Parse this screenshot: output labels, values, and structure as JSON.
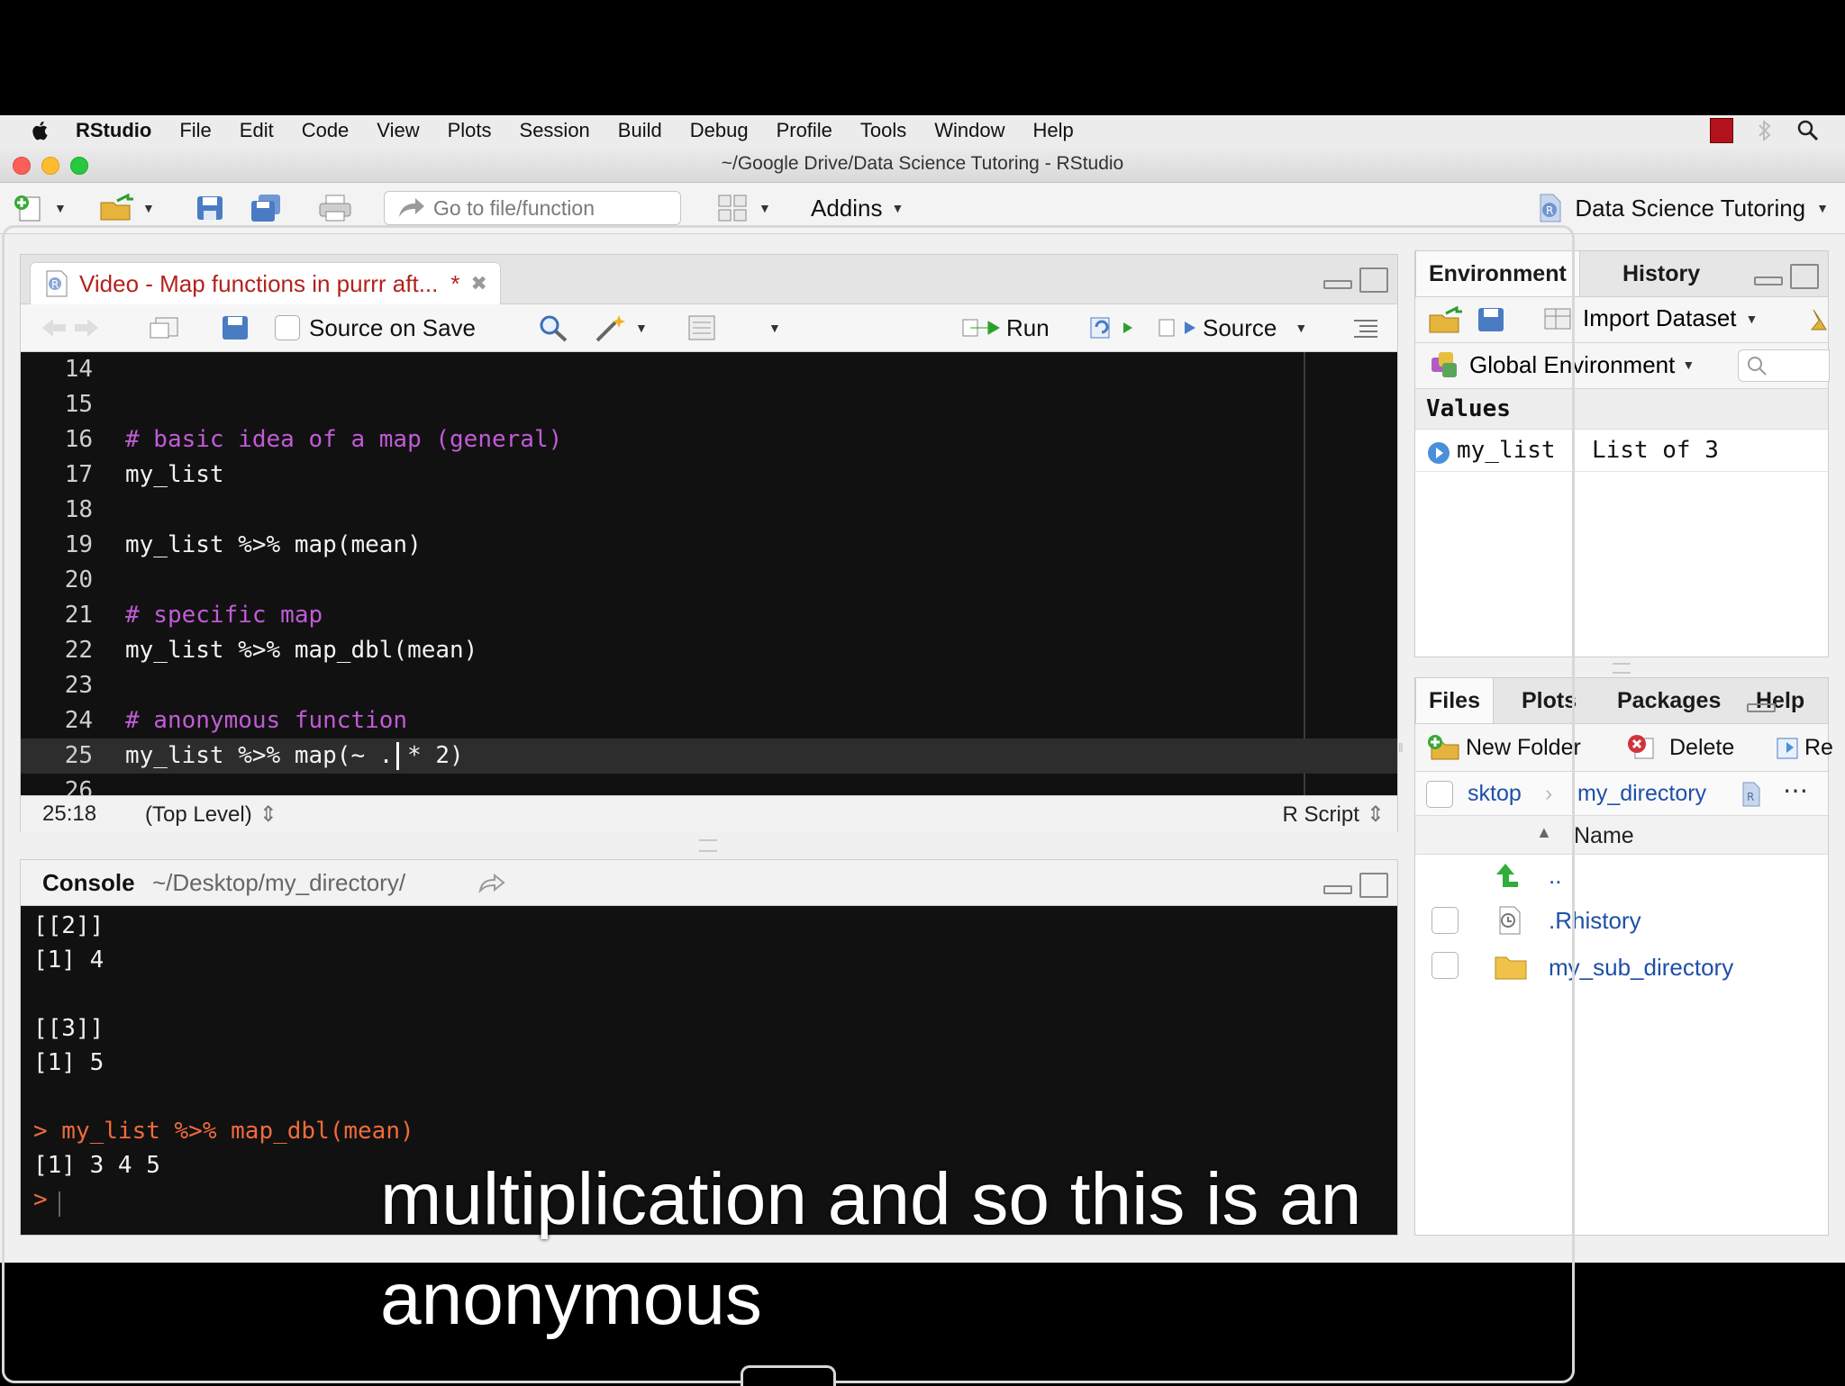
{
  "menubar": {
    "app_name": "RStudio",
    "items": [
      "File",
      "Edit",
      "Code",
      "View",
      "Plots",
      "Session",
      "Build",
      "Debug",
      "Profile",
      "Tools",
      "Window",
      "Help"
    ]
  },
  "window": {
    "title": "~/Google Drive/Data Science Tutoring - RStudio"
  },
  "toolbar": {
    "goto_placeholder": "Go to file/function",
    "addins_label": "Addins",
    "project_label": "Data Science Tutoring"
  },
  "editor": {
    "tab_title": "Video - Map functions in purrr aft...",
    "tab_modified": "*",
    "source_on_save_label": "Source on Save",
    "run_label": "Run",
    "source_label": "Source",
    "lines": [
      {
        "num": "14",
        "text": "",
        "type": "code"
      },
      {
        "num": "15",
        "text": "",
        "type": "code"
      },
      {
        "num": "16",
        "text": "# basic idea of a map (general)",
        "type": "comment"
      },
      {
        "num": "17",
        "text": "my_list",
        "type": "code"
      },
      {
        "num": "18",
        "text": "",
        "type": "code"
      },
      {
        "num": "19",
        "text": "my_list %>% map(mean)",
        "type": "code"
      },
      {
        "num": "20",
        "text": "",
        "type": "code"
      },
      {
        "num": "21",
        "text": "# specific map",
        "type": "comment"
      },
      {
        "num": "22",
        "text": "my_list %>% map_dbl(mean)",
        "type": "code"
      },
      {
        "num": "23",
        "text": "",
        "type": "code"
      },
      {
        "num": "24",
        "text": "# anonymous function",
        "type": "comment"
      },
      {
        "num": "25",
        "text": "my_list %>% map(~ . * 2)",
        "type": "code"
      },
      {
        "num": "26",
        "text": "",
        "type": "code"
      }
    ],
    "cursor_position": "25:18",
    "scope": "(Top Level)",
    "file_type": "R Script"
  },
  "console": {
    "title": "Console",
    "path": "~/Desktop/my_directory/",
    "lines": [
      {
        "text": "[[2]]",
        "type": "output"
      },
      {
        "text": "[1] 4",
        "type": "output"
      },
      {
        "text": "",
        "type": "output"
      },
      {
        "text": "[[3]]",
        "type": "output"
      },
      {
        "text": "[1] 5",
        "type": "output"
      },
      {
        "text": "",
        "type": "output"
      },
      {
        "text": "> my_list %>% map_dbl(mean)",
        "type": "command"
      },
      {
        "text": "[1] 3 4 5",
        "type": "output"
      },
      {
        "text": ">",
        "type": "command"
      }
    ]
  },
  "environment": {
    "tabs": [
      "Environment",
      "History"
    ],
    "import_label": "Import Dataset",
    "scope_label": "Global Environment",
    "section": "Values",
    "values": [
      {
        "name": "my_list",
        "value": "List of 3"
      }
    ]
  },
  "files": {
    "tabs": [
      "Files",
      "Plots",
      "Packages",
      "Help"
    ],
    "new_folder_label": "New Folder",
    "delete_label": "Delete",
    "rename_label": "Re",
    "breadcrumb_parent": "sktop",
    "breadcrumb_current": "my_directory",
    "name_header": "Name",
    "entries": [
      ".Rhistory",
      "my_sub_directory"
    ],
    "parent_entry": ".."
  },
  "captions": {
    "line1": "multiplication and so this is an",
    "line2": "anonymous"
  },
  "colors": {
    "comment": "#c15bd6",
    "console_command": "#ef6b3c",
    "tab_title": "#b3221c",
    "link": "#1f4fa8"
  }
}
